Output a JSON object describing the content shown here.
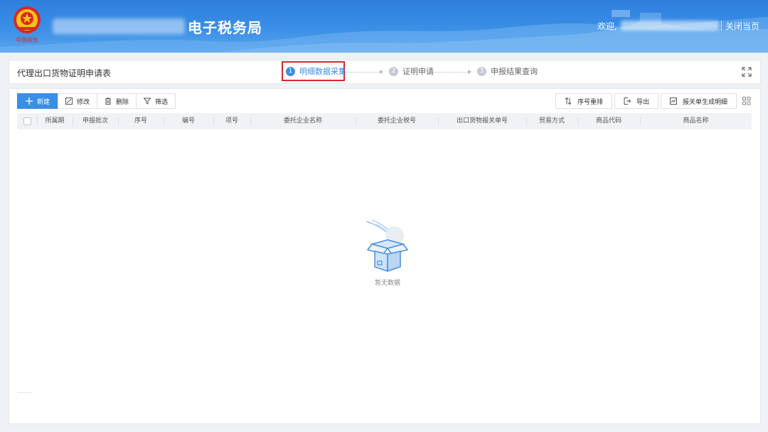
{
  "header": {
    "title": "电子税务局",
    "welcome": "欢迎,",
    "close_page": "关闭当页"
  },
  "stepbar": {
    "form_title": "代理出口货物证明申请表",
    "steps": [
      {
        "num": "1",
        "label": "明细数据采集"
      },
      {
        "num": "2",
        "label": "证明申请"
      },
      {
        "num": "3",
        "label": "申报结果查询"
      }
    ]
  },
  "toolbar": {
    "new_label": "新建",
    "edit_label": "修改",
    "delete_label": "删除",
    "filter_label": "筛选",
    "reorder_label": "序号重排",
    "export_label": "导出",
    "generate_label": "报关单生成明细"
  },
  "table": {
    "columns": [
      "所属期",
      "申报批次",
      "序号",
      "编号",
      "项号",
      "委托企业名称",
      "委托企业税号",
      "出口货物报关单号",
      "贸易方式",
      "商品代码",
      "商品名称"
    ]
  },
  "empty_state": {
    "text": "暂无数据"
  },
  "colors": {
    "header_blue": "#2e7fdc",
    "accent": "#3a8ee6",
    "highlight_border": "#d9262b"
  }
}
